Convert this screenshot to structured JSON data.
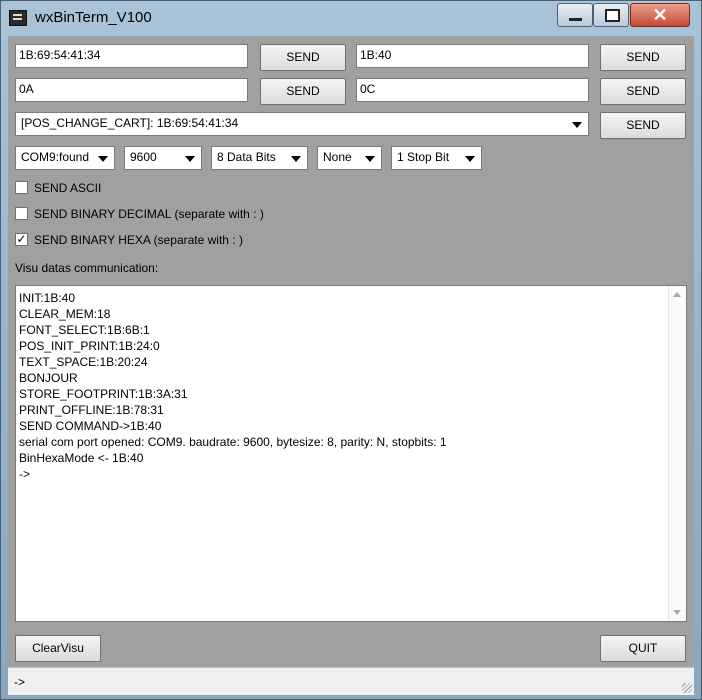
{
  "window": {
    "title": "wxBinTerm_V100",
    "controls": {
      "minimize": "minimize-icon",
      "maximize": "maximize-icon",
      "close": "close-icon"
    }
  },
  "send_rows": [
    {
      "left_value": "1B:69:54:41:34",
      "left_button": "SEND",
      "right_value": "1B:40",
      "right_button": "SEND"
    },
    {
      "left_value": "0A",
      "left_button": "SEND",
      "right_value": "0C",
      "right_button": "SEND"
    }
  ],
  "command_select": {
    "value": "[POS_CHANGE_CART]: 1B:69:54:41:34",
    "button": "SEND"
  },
  "serial": {
    "port": "COM9:found",
    "baudrate": "9600",
    "data_bits": "8 Data Bits",
    "parity": "None",
    "stop_bits": "1 Stop Bit"
  },
  "options": [
    {
      "label": "SEND ASCII",
      "checked": false
    },
    {
      "label": "SEND BINARY DECIMAL (separate with : )",
      "checked": false
    },
    {
      "label": "SEND BINARY HEXA (separate with : )",
      "checked": true
    }
  ],
  "visu_label": "Visu datas communication:",
  "log_lines": [
    "INIT:1B:40",
    "CLEAR_MEM:18",
    "FONT_SELECT:1B:6B:1",
    "POS_INIT_PRINT:1B:24:0",
    "TEXT_SPACE:1B:20:24",
    "BONJOUR",
    "STORE_FOOTPRINT:1B:3A:31",
    "PRINT_OFFLINE:1B:78:31",
    "SEND COMMAND->1B:40",
    "serial com port opened: COM9. baudrate: 9600, bytesize: 8, parity: N, stopbits: 1",
    "BinHexaMode <- 1B:40",
    "->"
  ],
  "buttons": {
    "clear": "ClearVisu",
    "quit": "QUIT"
  },
  "status": "->",
  "checkmark": "✓"
}
